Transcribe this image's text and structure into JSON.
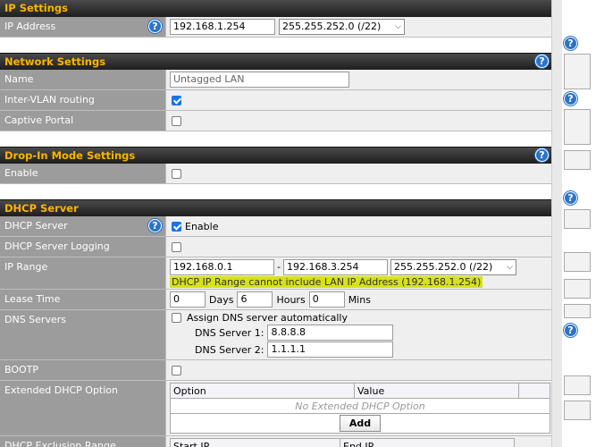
{
  "ip_settings": {
    "title": "IP Settings",
    "ip_address_label": "IP Address",
    "ip_address_value": "192.168.1.254",
    "subnet_value": "255.255.252.0 (/22)"
  },
  "network_settings": {
    "title": "Network Settings",
    "name_label": "Name",
    "name_value": "Untagged LAN",
    "inter_vlan_label": "Inter-VLAN routing",
    "captive_portal_label": "Captive Portal"
  },
  "dropin_settings": {
    "title": "Drop-In Mode Settings",
    "enable_label": "Enable"
  },
  "dhcp_server": {
    "title": "DHCP Server",
    "dhcp_server_label": "DHCP Server",
    "enable_text": "Enable",
    "logging_label": "DHCP Server Logging",
    "ip_range_label": "IP Range",
    "range_start": "192.168.0.1",
    "range_sep": "-",
    "range_end": "192.168.3.254",
    "range_subnet": "255.255.252.0 (/22)",
    "range_warning": "DHCP IP Range cannot include LAN IP Address (192.168.1.254)",
    "lease_time_label": "Lease Time",
    "lease_days": "0",
    "days_text": "Days",
    "lease_hours": "6",
    "hours_text": "Hours",
    "lease_mins": "0",
    "mins_text": "Mins",
    "dns_servers_label": "DNS Servers",
    "assign_dns_text": "Assign DNS server automatically",
    "dns1_label": "DNS Server 1:",
    "dns1_value": "8.8.8.8",
    "dns2_label": "DNS Server 2:",
    "dns2_value": "1.1.1.1",
    "bootp_label": "BOOTP",
    "ext_option_label": "Extended DHCP Option",
    "ext_col_option": "Option",
    "ext_col_value": "Value",
    "ext_empty": "No Extended DHCP Option",
    "add_button": "Add",
    "exclusion_label": "DHCP Exclusion Range",
    "excl_col_start": "Start IP",
    "excl_col_end": "End IP"
  },
  "help_glyph": "?"
}
